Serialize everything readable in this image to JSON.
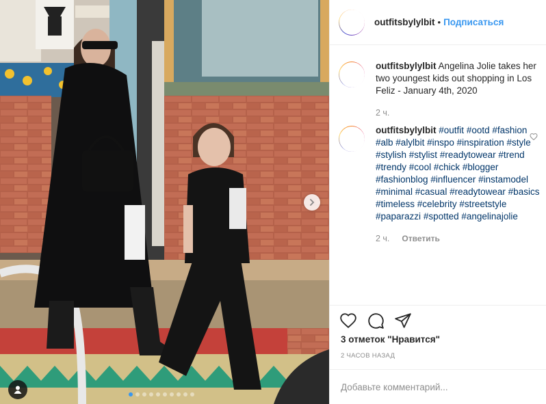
{
  "account": {
    "username": "outfitsbylylbit",
    "separator": "•",
    "follow_label": "Подписаться"
  },
  "caption": {
    "username": "outfitsbylylbit",
    "text": " Angelina Jolie takes her two youngest kids out shopping in Los Feliz - January 4th, 2020",
    "age": "2 ч."
  },
  "comment": {
    "username": "outfitsbylylbit",
    "hashtags": [
      "#outfit",
      "#ootd",
      "#fashion",
      "#alb",
      "#alylbit",
      "#inspo",
      "#inspiration",
      "#style",
      "#stylish",
      "#stylist",
      "#readytowear",
      "#trend",
      "#trendy",
      "#cool",
      "#chick",
      "#blogger",
      "#fashionblog",
      "#influencer",
      "#instamodel",
      "#minimal",
      "#casual",
      "#readytowear",
      "#basics",
      "#timeless",
      "#celebrity",
      "#streetstyle",
      "#paparazzi",
      "#spotted",
      "#angelinajolie"
    ],
    "age": "2 ч.",
    "reply_label": "Ответить"
  },
  "likes_text": "3 отметок \"Нравится\"",
  "time_ago": "2 ЧАСОВ НАЗАД",
  "comment_input": {
    "placeholder": "Добавьте комментарий..."
  },
  "carousel": {
    "slides": 10,
    "active_slide": 1
  },
  "colors": {
    "link": "#3897f0",
    "hashtag": "#003569",
    "muted": "#8e8e8e",
    "text": "#262626"
  },
  "icons": [
    "heart-icon",
    "comment-icon",
    "share-icon",
    "heart-outline-small-icon",
    "chevron-right-icon",
    "user-tag-icon"
  ]
}
